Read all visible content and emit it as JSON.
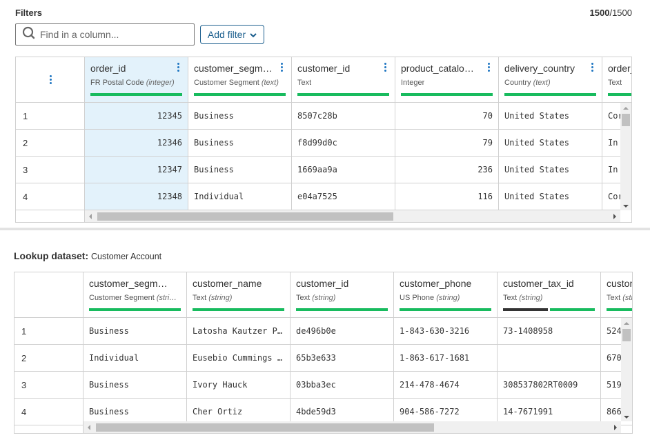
{
  "filters": {
    "title": "Filters",
    "count_shown": "1500",
    "count_total": "/1500",
    "search_placeholder": "Find in a column...",
    "add_filter_label": "Add filter"
  },
  "main_table": {
    "columns": [
      {
        "name": "order_id",
        "meaning": "FR Postal Code",
        "type": "(integer)",
        "selected": true,
        "align": "right"
      },
      {
        "name": "customer_segm…",
        "meaning": "Customer Segment",
        "type": "(text)",
        "align": "left"
      },
      {
        "name": "customer_id",
        "meaning": "Text",
        "type": "",
        "align": "left"
      },
      {
        "name": "product_catalo…",
        "meaning": "Integer",
        "type": "",
        "align": "right"
      },
      {
        "name": "delivery_country",
        "meaning": "Country",
        "type": "(text)",
        "align": "left"
      },
      {
        "name": "order_",
        "meaning": "Text",
        "type": "",
        "align": "left"
      }
    ],
    "rows": [
      {
        "index": "1",
        "cells": [
          "12345",
          "Business",
          "8507c28b",
          "70",
          "United States",
          "Cor"
        ]
      },
      {
        "index": "2",
        "cells": [
          "12346",
          "Business",
          "f8d99d0c",
          "79",
          "United States",
          "In"
        ]
      },
      {
        "index": "3",
        "cells": [
          "12347",
          "Business",
          "1669aa9a",
          "236",
          "United States",
          "In"
        ]
      },
      {
        "index": "4",
        "cells": [
          "12348",
          "Individual",
          "e04a7525",
          "116",
          "United States",
          "Cor"
        ]
      }
    ],
    "horizontal_scroll_fraction": 0.58
  },
  "lookup": {
    "label": "Lookup dataset:",
    "dataset_name": "Customer Account",
    "columns": [
      {
        "name": "customer_segment",
        "meaning": "Customer Segment",
        "type": "(stri…",
        "validity": 1.0
      },
      {
        "name": "customer_name",
        "meaning": "Text",
        "type": "(string)",
        "validity": 1.0
      },
      {
        "name": "customer_id",
        "meaning": "Text",
        "type": "(string)",
        "validity": 1.0
      },
      {
        "name": "customer_phone",
        "meaning": "US Phone",
        "type": "(string)",
        "validity": 1.0
      },
      {
        "name": "customer_tax_id",
        "meaning": "Text",
        "type": "(string)",
        "validity": 0.5,
        "empty_color": "#333333"
      },
      {
        "name": "custom",
        "meaning": "Text",
        "type": "(str",
        "validity": 1.0
      }
    ],
    "rows": [
      {
        "index": "1",
        "cells": [
          "Business",
          "Latosha Kautzer PhD",
          "de496b0e",
          "1-843-630-3216",
          "73-1408958",
          "524"
        ]
      },
      {
        "index": "2",
        "cells": [
          "Individual",
          "Eusebio Cummings P…",
          "65b3e633",
          "1-863-617-1681",
          "",
          "670"
        ]
      },
      {
        "index": "3",
        "cells": [
          "Business",
          "Ivory Hauck",
          "03bba3ec",
          "214-478-4674",
          "308537802RT0009",
          "519"
        ]
      },
      {
        "index": "4",
        "cells": [
          "Business",
          "Cher Ortiz",
          "4bde59d3",
          "904-586-7272",
          "14-7671991",
          "866"
        ]
      }
    ],
    "horizontal_scroll_fraction": 0.66
  },
  "colors": {
    "accent": "#1c5f8e",
    "valid_bar": "#18bb5e",
    "selected_column": "#e3f2fb",
    "kebab": "#1f76c2"
  }
}
